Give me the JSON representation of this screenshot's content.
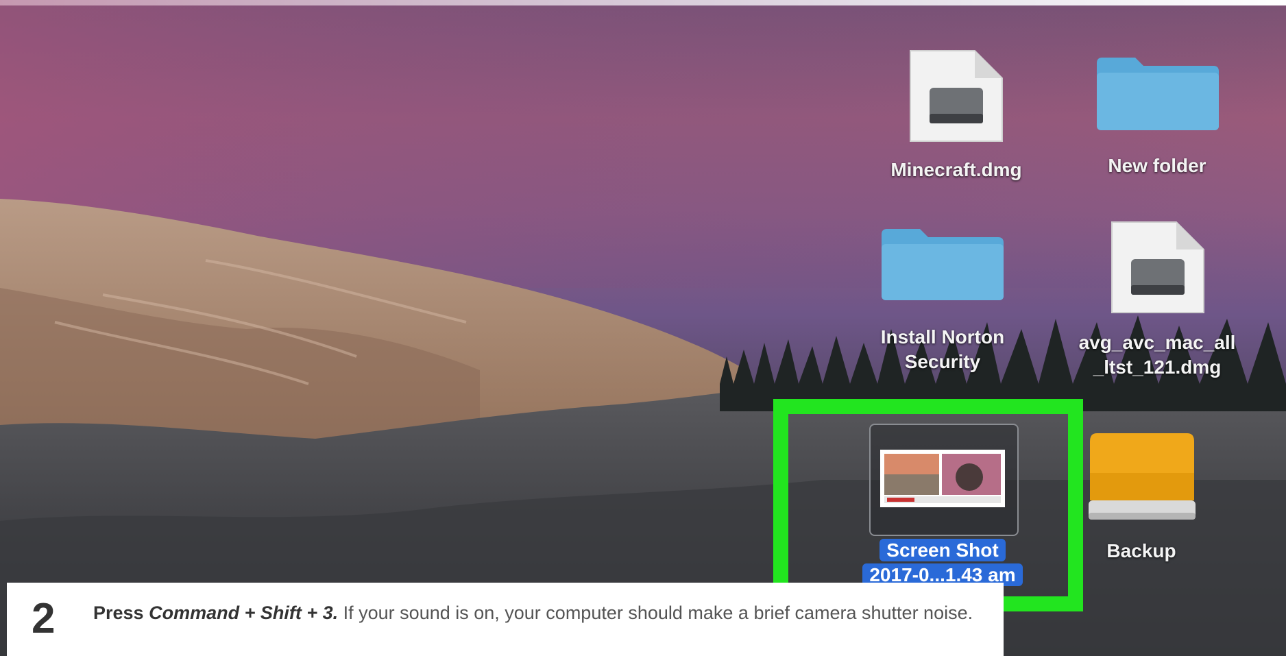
{
  "desktop": {
    "wallpaper": "Yosemite El Capitan wallpaper",
    "icons": [
      {
        "name": "Minecraft.dmg",
        "type": "disk-image"
      },
      {
        "name": "New folder",
        "type": "folder"
      },
      {
        "name_line1": "Install Norton",
        "name_line2": "Security",
        "type": "folder"
      },
      {
        "name_line1": "avg_avc_mac_all",
        "name_line2": "_ltst_121.dmg",
        "type": "disk-image"
      },
      {
        "name_line1": "Screen Shot",
        "name_line2": "2017-0...1.43 am",
        "type": "screenshot",
        "selected": true
      },
      {
        "name": "Backup",
        "type": "external-drive"
      }
    ],
    "highlight_color": "#22e51f",
    "selection_color": "#2a6ad8"
  },
  "caption": {
    "step_number": "2",
    "action_prefix": "Press ",
    "action": "Command + Shift + 3.",
    "description": " If your sound is on, your computer should make a brief camera shutter noise."
  }
}
